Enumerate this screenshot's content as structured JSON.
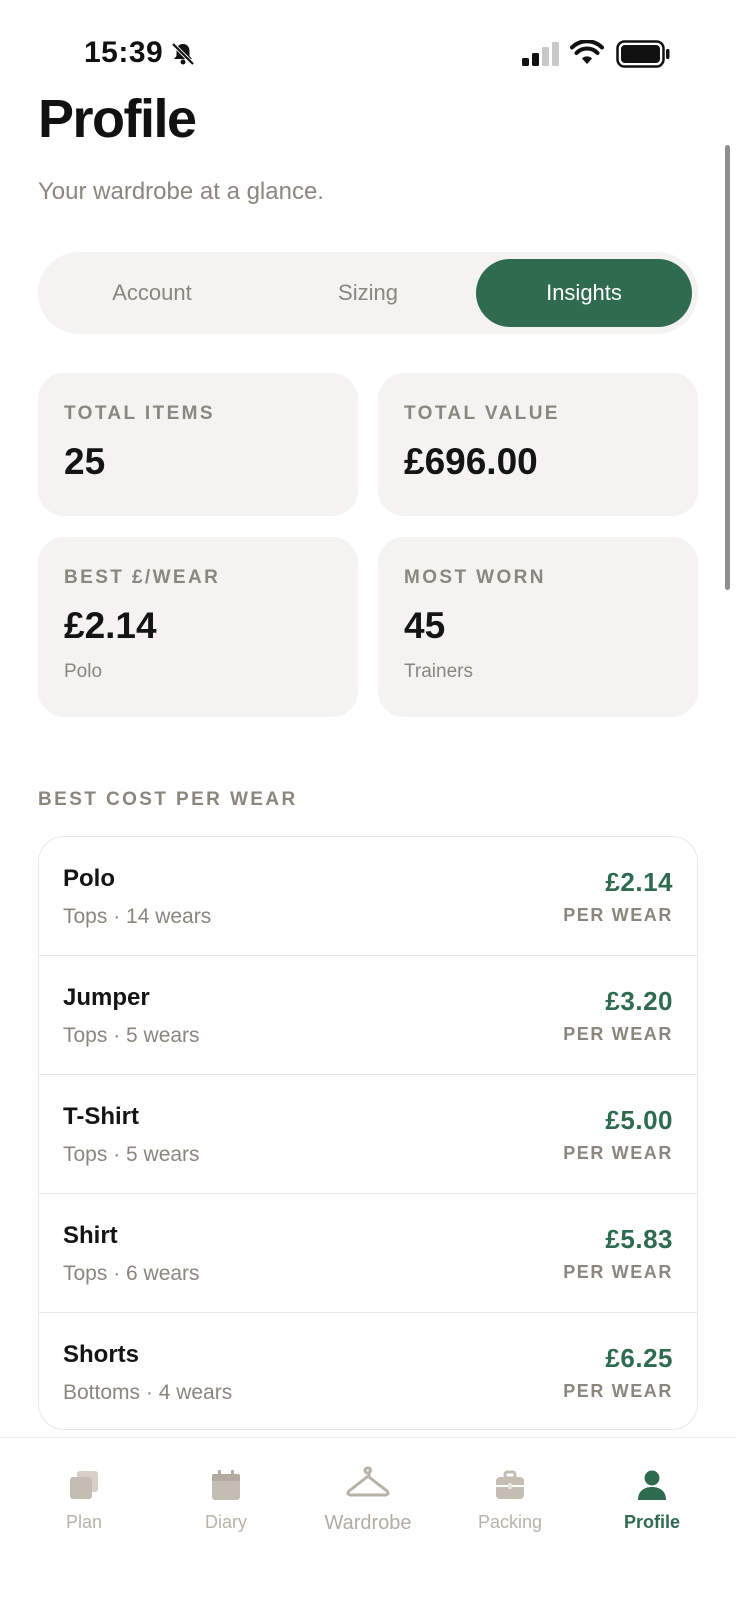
{
  "status_bar": {
    "time": "15:39"
  },
  "header": {
    "title": "Profile",
    "subtitle": "Your wardrobe at a glance."
  },
  "segments": [
    {
      "label": "Account",
      "active": false
    },
    {
      "label": "Sizing",
      "active": false
    },
    {
      "label": "Insights",
      "active": true
    }
  ],
  "stats": {
    "total_items": {
      "label": "TOTAL ITEMS",
      "value": "25"
    },
    "total_value": {
      "label": "TOTAL VALUE",
      "value": "£696.00"
    },
    "best_per_wear": {
      "label": "BEST £/WEAR",
      "value": "£2.14",
      "sub": "Polo"
    },
    "most_worn": {
      "label": "MOST WORN",
      "value": "45",
      "sub": "Trainers"
    }
  },
  "section": {
    "title": "BEST COST PER WEAR"
  },
  "items": [
    {
      "name": "Polo",
      "meta": "Tops · 14 wears",
      "price": "£2.14",
      "unit": "PER WEAR"
    },
    {
      "name": "Jumper",
      "meta": "Tops · 5 wears",
      "price": "£3.20",
      "unit": "PER WEAR"
    },
    {
      "name": "T-Shirt",
      "meta": "Tops · 5 wears",
      "price": "£5.00",
      "unit": "PER WEAR"
    },
    {
      "name": "Shirt",
      "meta": "Tops · 6 wears",
      "price": "£5.83",
      "unit": "PER WEAR"
    },
    {
      "name": "Shorts",
      "meta": "Bottoms · 4 wears",
      "price": "£6.25",
      "unit": "PER WEAR"
    }
  ],
  "tab_bar": {
    "tabs": [
      {
        "label": "Plan",
        "icon": "cards-icon"
      },
      {
        "label": "Diary",
        "icon": "calendar-icon"
      },
      {
        "label": "Wardrobe",
        "icon": "hanger-icon"
      },
      {
        "label": "Packing",
        "icon": "suitcase-icon"
      },
      {
        "label": "Profile",
        "icon": "person-icon",
        "active": true
      }
    ]
  },
  "colors": {
    "accent": "#2e6b4f",
    "muted_text": "#8b867e",
    "card_bg": "#f4f3f1",
    "inactive_icon": "#c4bdb3"
  }
}
